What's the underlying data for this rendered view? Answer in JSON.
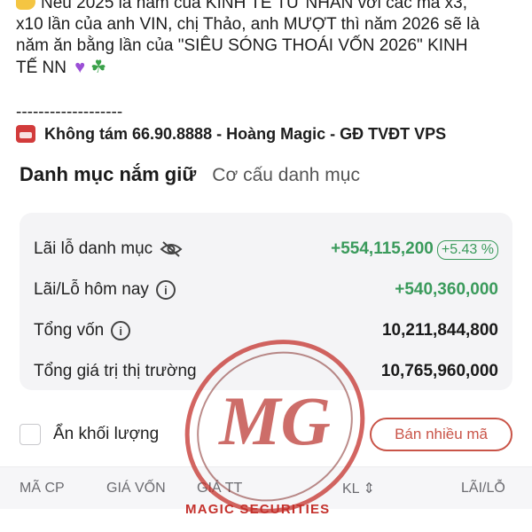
{
  "post": {
    "line1": "Nếu 2025 là năm của KINH TẾ TƯ NHÂN với các mã x3,",
    "line2": "x10 lần của anh VIN, chị Thảo, anh MƯỢT thì năm 2026 sẽ là",
    "line3": "năm ăn bằng lần của \"SIÊU SÓNG THOÁI VỐN 2026\" KINH",
    "line4": "TẾ NN",
    "divider": "-------------------",
    "contact": "Không tám 66.90.8888 - Hoàng Magic - GĐ TVĐT VPS"
  },
  "tabs": {
    "active": "Danh mục nắm giữ",
    "inactive": "Cơ cấu danh mục"
  },
  "summary": {
    "pnl_label": "Lãi lỗ danh mục",
    "pnl_value": "+554,115,200",
    "pnl_pct": "+5.43 %",
    "today_label": "Lãi/Lỗ hôm nay",
    "today_value": "+540,360,000",
    "capital_label": "Tổng vốn",
    "capital_value": "10,211,844,800",
    "market_label": "Tổng giá trị thị trường",
    "market_value": "10,765,960,000"
  },
  "controls": {
    "hide_volume_label": "Ẩn khối lượng",
    "sell_multi_label": "Bán nhiều mã"
  },
  "table": {
    "col_code": "MÃ CP",
    "col_cost": "GIÁ VỐN",
    "col_price": "GIÁ TT",
    "col_volume": "KL",
    "col_pnl": "LÃI/LỖ"
  },
  "watermark": {
    "caption": "MAGIC SECURITIES",
    "logo_text": "MG"
  },
  "colors": {
    "profit_green": "#3a9a5b",
    "sell_red": "#c95448",
    "watermark_red": "#c4312c"
  }
}
